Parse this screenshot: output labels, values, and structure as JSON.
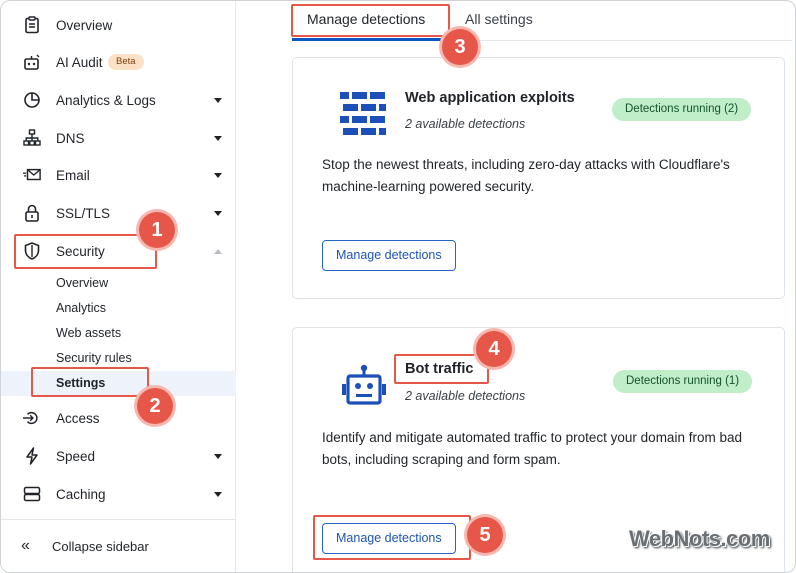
{
  "sidebar": {
    "items": [
      {
        "label": "Overview",
        "icon": "clipboard-icon"
      },
      {
        "label": "AI Audit",
        "icon": "robot-icon",
        "badge": "Beta"
      },
      {
        "label": "Analytics & Logs",
        "icon": "pie-chart-icon"
      },
      {
        "label": "DNS",
        "icon": "network-icon"
      },
      {
        "label": "Email",
        "icon": "email-icon"
      },
      {
        "label": "SSL/TLS",
        "icon": "lock-icon"
      },
      {
        "label": "Security",
        "icon": "shield-icon"
      },
      {
        "label": "Access",
        "icon": "access-icon"
      },
      {
        "label": "Speed",
        "icon": "bolt-icon"
      },
      {
        "label": "Caching",
        "icon": "database-icon"
      }
    ],
    "security_sub": [
      "Overview",
      "Analytics",
      "Web assets",
      "Security rules",
      "Settings"
    ],
    "collapse_label": "Collapse sidebar"
  },
  "tabs": [
    "Manage detections",
    "All settings"
  ],
  "cards": [
    {
      "title": "Web application exploits",
      "subtitle": "2 available detections",
      "status": "Detections running (2)",
      "description": "Stop the newest threats, including zero-day attacks with Cloudflare's machine-learning powered security.",
      "button": "Manage detections"
    },
    {
      "title": "Bot traffic",
      "subtitle": "2 available detections",
      "status": "Detections running (1)",
      "description": "Identify and mitigate automated traffic to protect your domain from bad bots, including scraping and form spam.",
      "button": "Manage detections"
    }
  ],
  "annotations": [
    "1",
    "2",
    "3",
    "4",
    "5"
  ],
  "watermark": "WebNots.com",
  "colors": {
    "accent": "#0b58c4",
    "annotation": "#e6574a",
    "status_bg": "#bfeec9",
    "icon_blue": "#1d4fb8"
  }
}
